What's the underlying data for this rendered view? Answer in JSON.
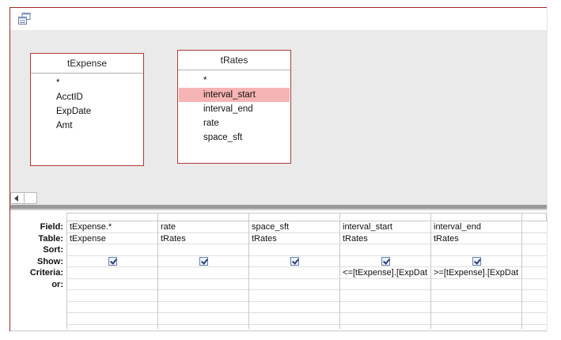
{
  "colors": {
    "border": "#9e2a2a",
    "selected_field": "#f7b4b4",
    "upper_bg": "#eaeaea"
  },
  "window": {
    "icon": "query-design-icon"
  },
  "tables": [
    {
      "title": "tExpense",
      "fields": [
        "*",
        "AcctID",
        "ExpDate",
        "Amt"
      ]
    },
    {
      "title": "tRates",
      "fields": [
        "*",
        "interval_start",
        "interval_end",
        "rate",
        "space_sft"
      ],
      "selected_index": 1
    }
  ],
  "grid": {
    "row_labels": [
      "Field:",
      "Table:",
      "Sort:",
      "Show:",
      "Criteria:",
      "or:"
    ],
    "columns": [
      {
        "field": "tExpense.*",
        "table": "tExpense",
        "sort": "",
        "show": true,
        "criteria": "",
        "or": ""
      },
      {
        "field": "rate",
        "table": "tRates",
        "sort": "",
        "show": true,
        "criteria": "",
        "or": ""
      },
      {
        "field": "space_sft",
        "table": "tRates",
        "sort": "",
        "show": true,
        "criteria": "",
        "or": ""
      },
      {
        "field": "interval_start",
        "table": "tRates",
        "sort": "",
        "show": true,
        "criteria": "<=[tExpense].[ExpDat",
        "or": ""
      },
      {
        "field": "interval_end",
        "table": "tRates",
        "sort": "",
        "show": true,
        "criteria": ">=[tExpense].[ExpDat",
        "or": ""
      },
      {
        "field": "",
        "table": "",
        "sort": "",
        "show": false,
        "criteria": "",
        "or": ""
      }
    ]
  }
}
